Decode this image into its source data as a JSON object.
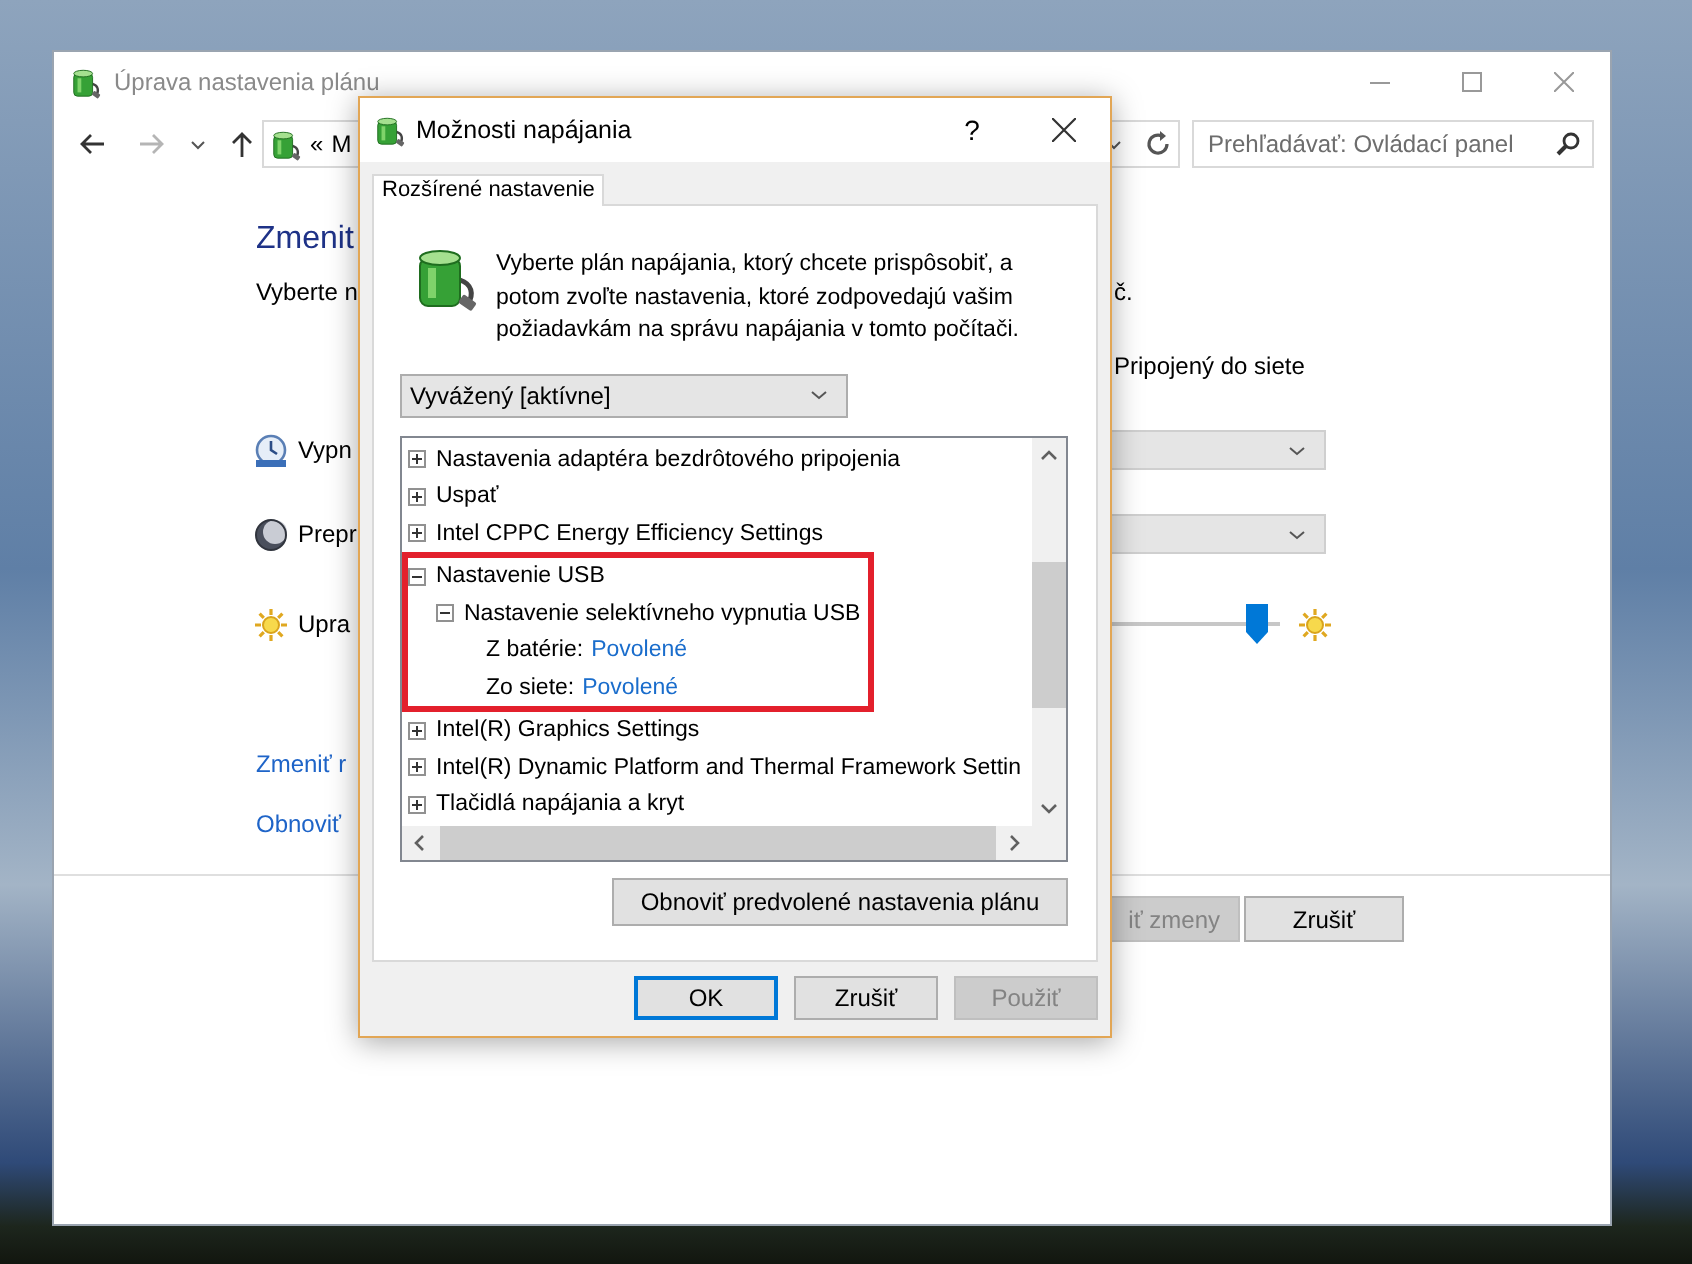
{
  "main_window": {
    "title": "Úprava nastavenia plánu",
    "address_bar": {
      "overflow": "«",
      "crumb": "M"
    },
    "search": {
      "placeholder": "Prehľadávať: Ovládací panel"
    },
    "heading": "Zmenit",
    "subtitle": "Vyberte n",
    "subtitle_end": "č.",
    "column_header": "Pripojený do siete",
    "settings": [
      {
        "kind": "dropdown",
        "label": "Vypn"
      },
      {
        "kind": "dropdown",
        "label": "Prepr"
      },
      {
        "kind": "slider",
        "label": "Upra",
        "level": 0.97
      }
    ],
    "links": [
      "Zmeniť r",
      "Obnoviť"
    ],
    "buttons": [
      {
        "label": "iť zmeny",
        "disabled": true
      },
      {
        "label": "Zrušiť",
        "disabled": false
      }
    ]
  },
  "dialog": {
    "title": "Možnosti napájania",
    "help": "?",
    "tabs": [
      {
        "label": "Rozšírené nastavenie",
        "selected": true
      }
    ],
    "description": "Vyberte plán napájania, ktorý chcete prispôsobiť, a potom zvoľte nastavenia, ktoré zodpovedajú vašim požiadavkám na správu napájania v tomto počítači.",
    "plan_dropdown": {
      "value": "Vyvážený [aktívne]"
    },
    "tree": [
      {
        "kind": "group",
        "label": "Nastavenia adaptéra bezdrôtového pripojenia",
        "expanded": false,
        "highlighted": false
      },
      {
        "kind": "group",
        "label": "Uspať",
        "expanded": false,
        "highlighted": false
      },
      {
        "kind": "group",
        "label": "Intel CPPC Energy Efficiency Settings",
        "expanded": false,
        "highlighted": false
      },
      {
        "kind": "group",
        "label": "Nastavenie USB",
        "expanded": true,
        "highlighted": true,
        "children": [
          {
            "kind": "group",
            "label": "Nastavenie selektívneho vypnutia USB",
            "expanded": true,
            "children": [
              {
                "kind": "setting",
                "label": "Z batérie:",
                "value": "Povolené"
              },
              {
                "kind": "setting",
                "label": "Zo siete:",
                "value": "Povolené"
              }
            ]
          }
        ]
      },
      {
        "kind": "group",
        "label": "Intel(R) Graphics Settings",
        "expanded": false,
        "highlighted": false
      },
      {
        "kind": "group",
        "label": "Intel(R) Dynamic Platform and Thermal Framework Settin",
        "expanded": false,
        "highlighted": false
      },
      {
        "kind": "group",
        "label": "Tlačidlá napájania a kryt",
        "expanded": false,
        "highlighted": false
      }
    ],
    "restore_button": "Obnoviť predvolené nastavenia plánu",
    "buttons": [
      {
        "label": "OK",
        "default": true,
        "disabled": false
      },
      {
        "label": "Zrušiť",
        "default": false,
        "disabled": false
      },
      {
        "label": "Použiť",
        "default": false,
        "disabled": true
      }
    ]
  }
}
